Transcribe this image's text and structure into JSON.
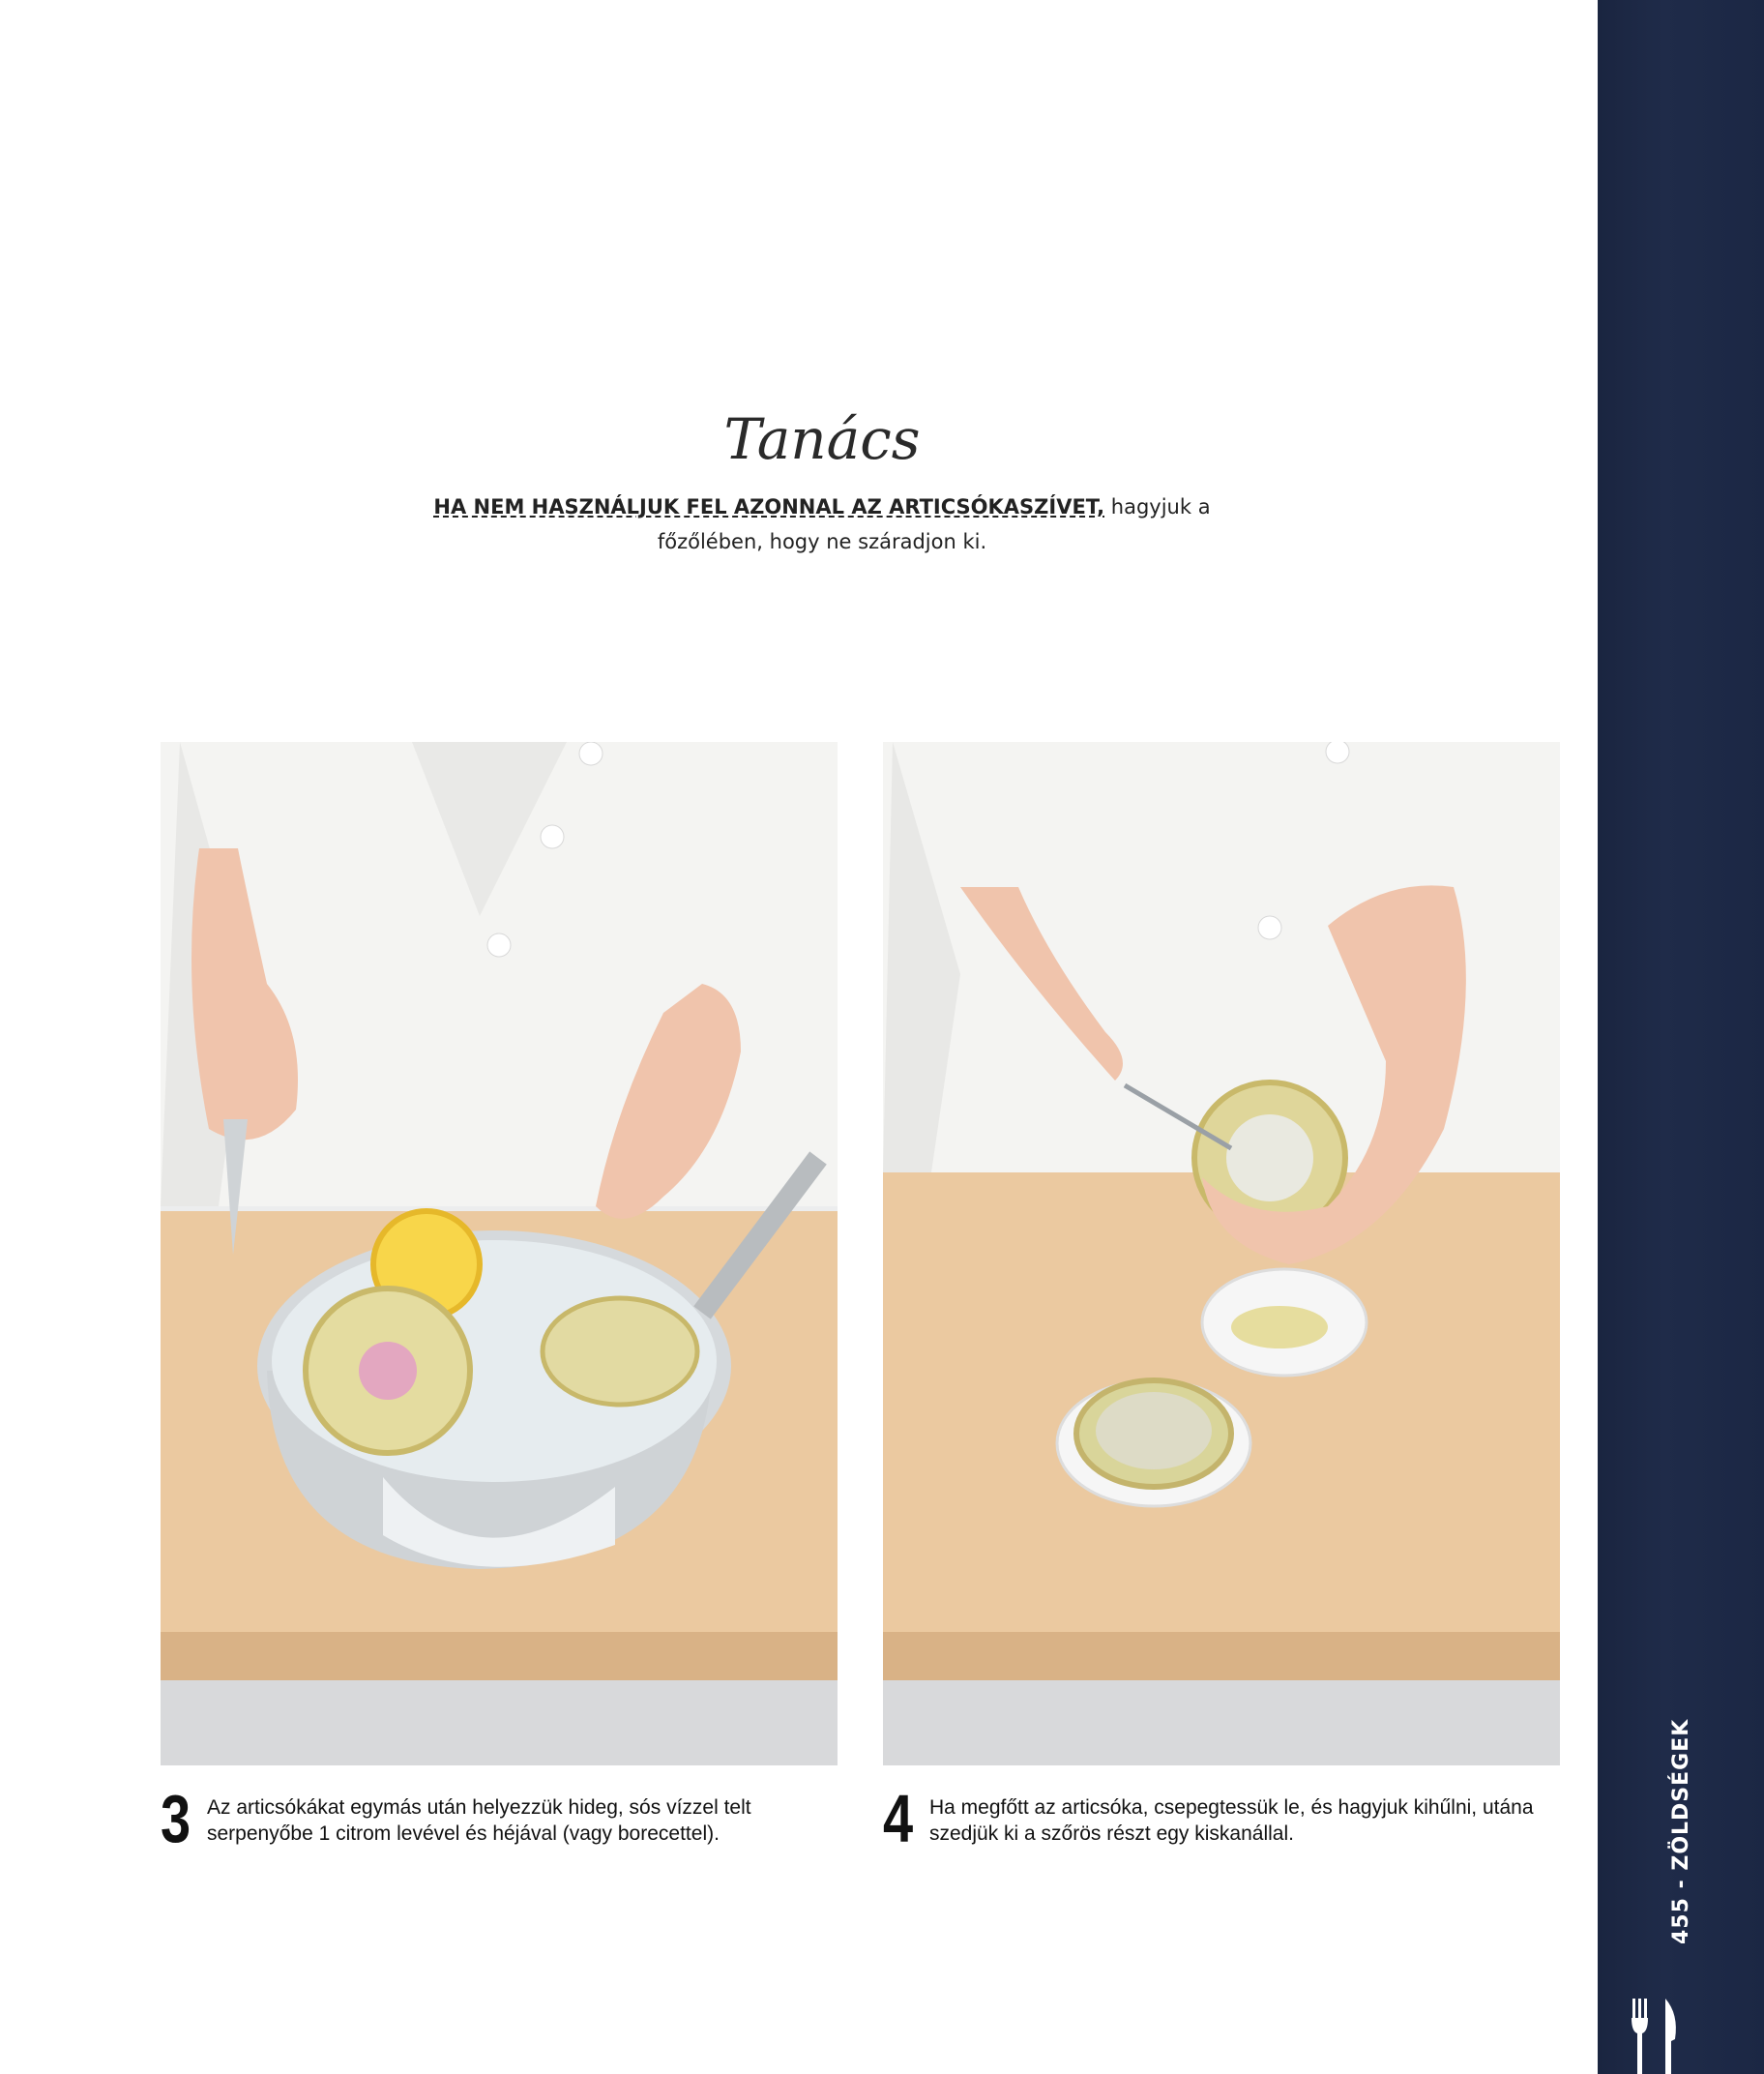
{
  "tip": {
    "title": "Tanács",
    "text_strong": "HA NEM HASZNÁLJUK FEL AZONNAL AZ ARTICSÓKASZÍVET,",
    "text_rest": " hagyjuk a főzőlében, hogy ne száradjon ki."
  },
  "steps": [
    {
      "number": "3",
      "text": "Az articsókákat egymás után helyezzük hideg, sós vízzel telt serpenyőbe 1 citrom levével és héjával (vagy borecettel)."
    },
    {
      "number": "4",
      "text": "Ha megfőtt az articsóka, csepegtessük le, és hagyjuk kihűlni, utána szedjük ki a szőrös részt egy kiskanállal."
    }
  ],
  "sidebar": {
    "label": "455 - ZÖLDSÉGEK",
    "icon": "cutlery-icon",
    "color": "#1f2b49"
  }
}
